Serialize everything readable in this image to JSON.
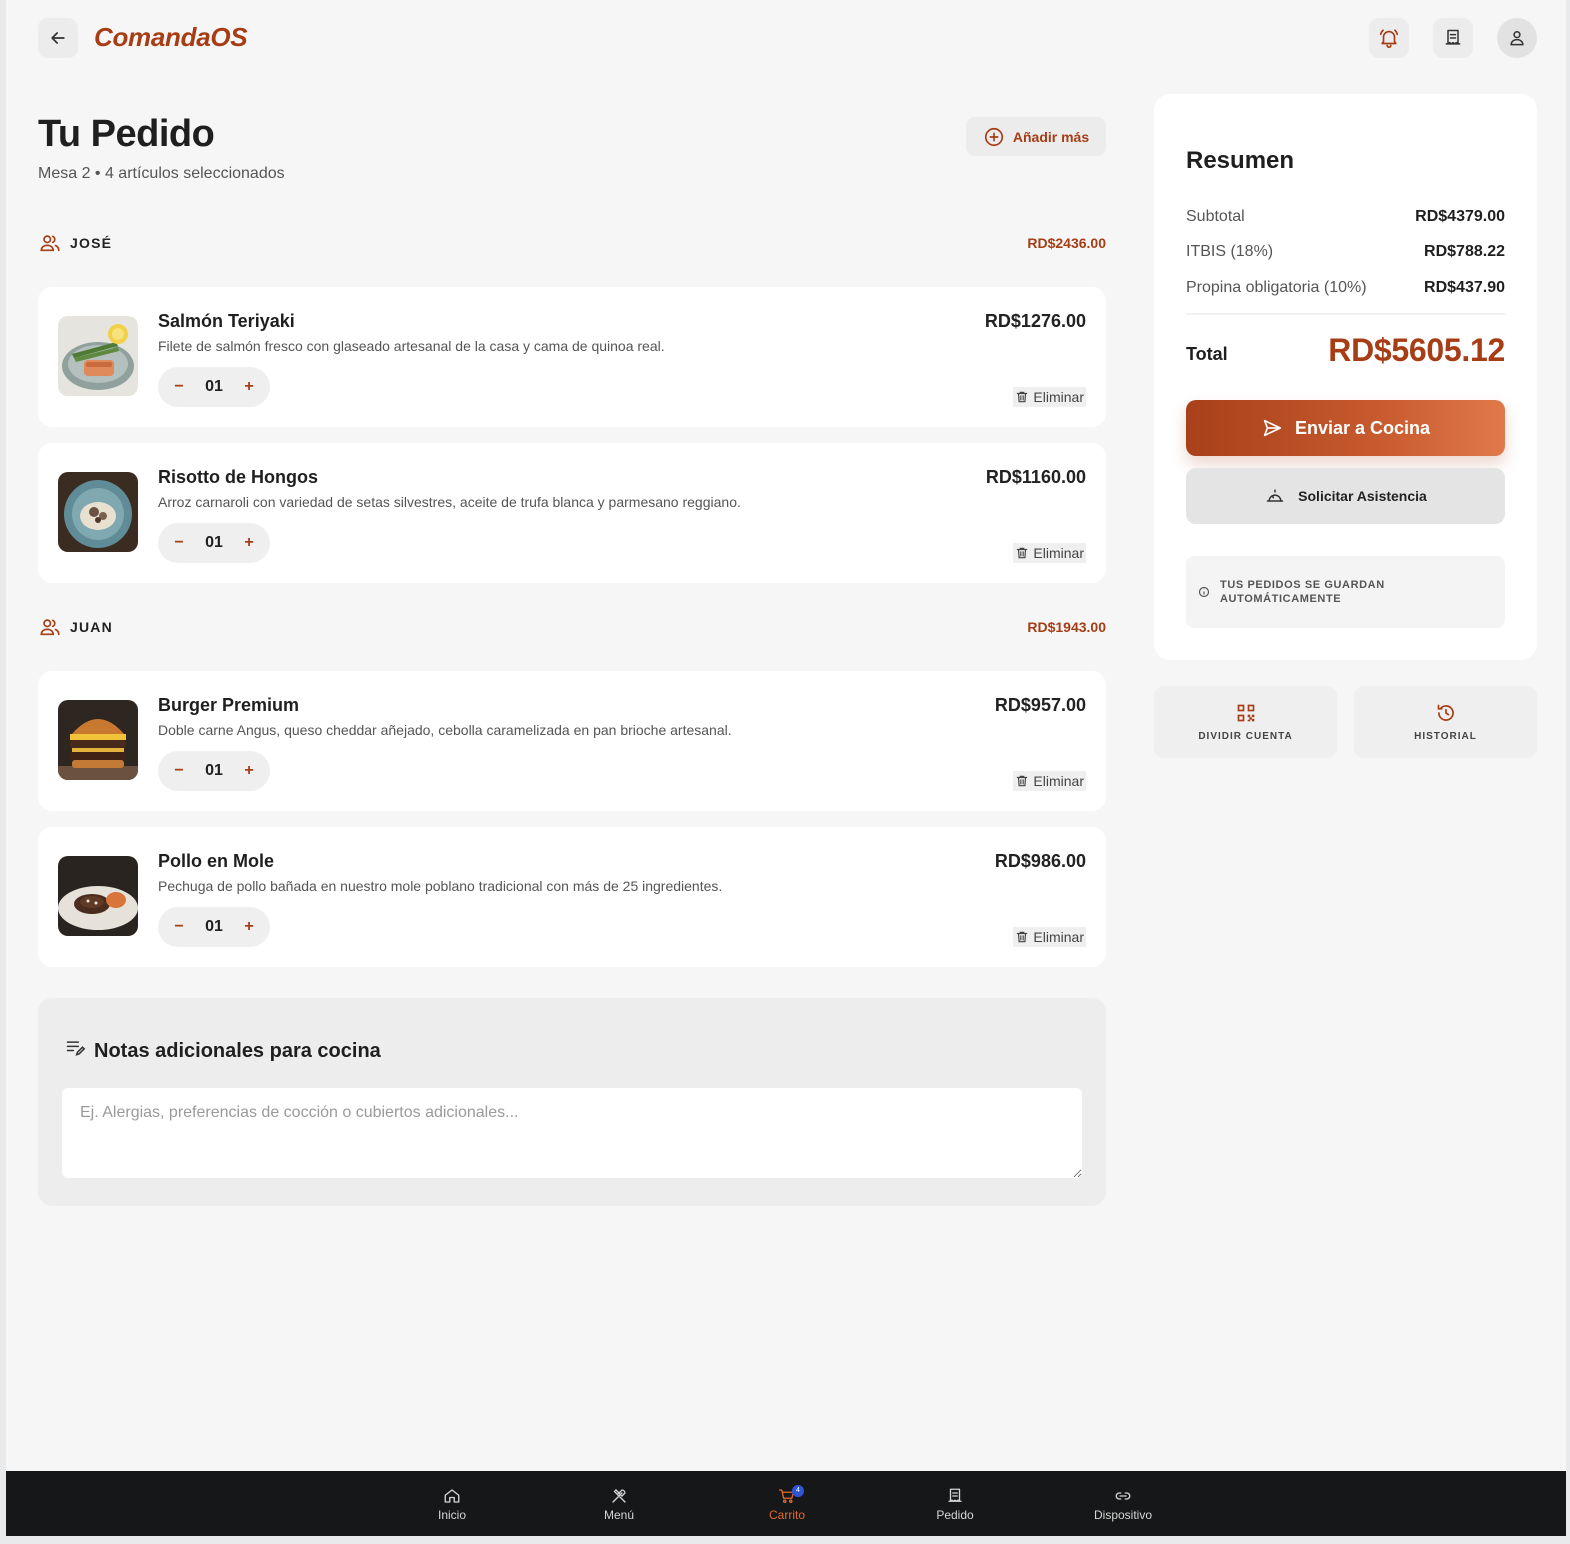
{
  "app": {
    "brand": "ComandaOS"
  },
  "page": {
    "title": "Tu Pedido",
    "subtitle": "Mesa 2 • 4 artículos seleccionados",
    "add_more_label": "Añadir más"
  },
  "groups": [
    {
      "name": "JOSÉ",
      "amount": "RD$2436.00",
      "items": [
        {
          "title": "Salmón Teriyaki",
          "desc": "Filete de salmón fresco con glaseado artesanal de la casa y cama de quinoa real.",
          "price": "RD$1276.00",
          "qty": "01",
          "remove": "Eliminar"
        },
        {
          "title": "Risotto de Hongos",
          "desc": "Arroz carnaroli con variedad de setas silvestres, aceite de trufa blanca y parmesano reggiano.",
          "price": "RD$1160.00",
          "qty": "01",
          "remove": "Eliminar"
        }
      ]
    },
    {
      "name": "JUAN",
      "amount": "RD$1943.00",
      "items": [
        {
          "title": "Burger Premium",
          "desc": "Doble carne Angus, queso cheddar añejado, cebolla caramelizada en pan brioche artesanal.",
          "price": "RD$957.00",
          "qty": "01",
          "remove": "Eliminar"
        },
        {
          "title": "Pollo en Mole",
          "desc": "Pechuga de pollo bañada en nuestro mole poblano tradicional con más de 25 ingredientes.",
          "price": "RD$986.00",
          "qty": "01",
          "remove": "Eliminar"
        }
      ]
    }
  ],
  "notes": {
    "title": "Notas adicionales para cocina",
    "placeholder": "Ej. Alergias, preferencias de cocción o cubiertos adicionales..."
  },
  "summary": {
    "title": "Resumen",
    "rows": [
      {
        "label": "Subtotal",
        "value": "RD$4379.00"
      },
      {
        "label": "ITBIS (18%)",
        "value": "RD$788.22"
      },
      {
        "label": "Propina obligatoria (10%)",
        "value": "RD$437.90"
      }
    ],
    "total_label": "Total",
    "total_value": "RD$5605.12",
    "send_label": "Enviar a Cocina",
    "assist_label": "Solicitar Asistencia",
    "info_text": "TUS PEDIDOS SE GUARDAN AUTOMÁTICAMENTE"
  },
  "tiles": [
    {
      "label": "DIVIDIR CUENTA",
      "icon": "qr-code-icon"
    },
    {
      "label": "HISTORIAL",
      "icon": "history-icon"
    }
  ],
  "nav": [
    {
      "label": "Inicio",
      "icon": "home-icon"
    },
    {
      "label": "Menú",
      "icon": "utensils-icon"
    },
    {
      "label": "Carrito",
      "icon": "cart-icon",
      "active": true,
      "badge": "4"
    },
    {
      "label": "Pedido",
      "icon": "receipt-icon"
    },
    {
      "label": "Dispositivo",
      "icon": "link-icon"
    }
  ],
  "colors": {
    "accent": "#a63d15",
    "accent_light": "#e16a2e",
    "badge": "#2f55d4",
    "nav_bg": "#161718"
  }
}
